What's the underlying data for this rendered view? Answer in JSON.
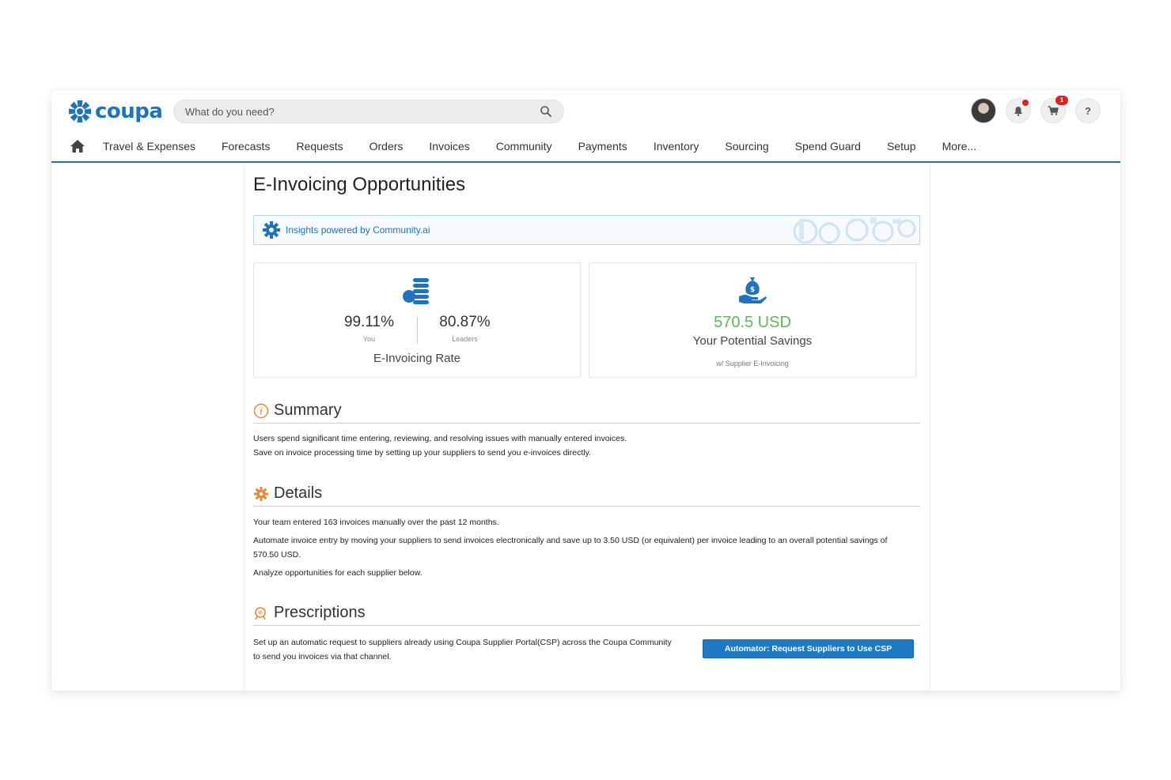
{
  "app": {
    "logo_text": "coupa",
    "brand_color": "#1e73be"
  },
  "search": {
    "placeholder": "What do you need?"
  },
  "header": {
    "cart_badge": "1"
  },
  "nav": {
    "items": [
      "Travel & Expenses",
      "Forecasts",
      "Requests",
      "Orders",
      "Invoices",
      "Community",
      "Payments",
      "Inventory",
      "Sourcing",
      "Spend Guard",
      "Setup",
      "More..."
    ]
  },
  "page": {
    "title": "E-Invoicing Opportunities",
    "insights": "Insights powered by Community.ai"
  },
  "rate_card": {
    "you_value": "99.11%",
    "you_label": "You",
    "leaders_value": "80.87%",
    "leaders_label": "Leaders",
    "caption": "E-Invoicing Rate"
  },
  "savings_card": {
    "value": "570.5 USD",
    "label": "Your Potential Savings",
    "sub": "w/ Supplier E-Invoicing",
    "value_color": "#5cb85c"
  },
  "summary": {
    "title": "Summary",
    "lines": [
      "Users spend significant time entering, reviewing, and resolving issues with manually entered invoices.",
      "Save on invoice processing time by setting up your suppliers to send you e-invoices directly."
    ]
  },
  "details": {
    "title": "Details",
    "lines": [
      "Your team entered 163 invoices manually over the past 12 months.",
      "Automate invoice entry by moving your suppliers to send invoices electronically and save up to 3.50 USD (or equivalent) per invoice leading to an overall potential savings of 570.50 USD.",
      "Analyze opportunities for each supplier below."
    ]
  },
  "prescriptions": {
    "title": "Prescriptions",
    "text": "Set up an automatic request to suppliers already using Coupa Supplier Portal(CSP) across the Coupa Community to send you invoices via that channel.",
    "button": "Automator: Request Suppliers to Use CSP"
  }
}
